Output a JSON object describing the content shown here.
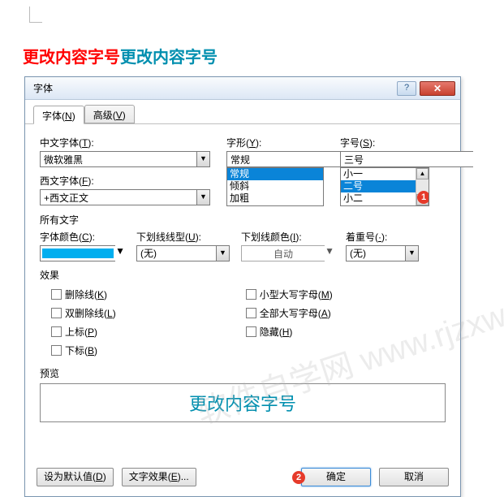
{
  "header": {
    "red": "更改内容字号",
    "teal": "更改内容字号"
  },
  "dialog": {
    "title": "字体",
    "tabs": [
      {
        "label": "字体",
        "accel": "N"
      },
      {
        "label": "高级",
        "accel": "V"
      }
    ],
    "cn_font": {
      "label": "中文字体",
      "accel": "T",
      "value": "微软雅黑"
    },
    "west_font": {
      "label": "西文字体",
      "accel": "F",
      "value": "+西文正文"
    },
    "style": {
      "label": "字形",
      "accel": "Y",
      "value": "常规",
      "options": [
        "常规",
        "倾斜",
        "加粗"
      ]
    },
    "size": {
      "label": "字号",
      "accel": "S",
      "value": "三号",
      "options": [
        "小一",
        "二号",
        "小二"
      ],
      "selected_index": 1
    },
    "all_text": "所有文字",
    "font_color": {
      "label": "字体颜色",
      "accel": "C",
      "swatch": "#00aeef"
    },
    "underline": {
      "label": "下划线线型",
      "accel": "U",
      "value": "(无)"
    },
    "underline_color": {
      "label": "下划线颜色",
      "accel": "I",
      "value": "自动"
    },
    "emphasis": {
      "label": "着重号",
      "accel": "·",
      "value": "(无)"
    },
    "effects_label": "效果",
    "effects_left": [
      {
        "label": "删除线",
        "accel": "K"
      },
      {
        "label": "双删除线",
        "accel": "L"
      },
      {
        "label": "上标",
        "accel": "P"
      },
      {
        "label": "下标",
        "accel": "B"
      }
    ],
    "effects_right": [
      {
        "label": "小型大写字母",
        "accel": "M"
      },
      {
        "label": "全部大写字母",
        "accel": "A"
      },
      {
        "label": "隐藏",
        "accel": "H"
      }
    ],
    "preview_label": "预览",
    "preview_text": "更改内容字号",
    "buttons": {
      "set_default": {
        "label": "设为默认值",
        "accel": "D"
      },
      "text_effects": {
        "label": "文字效果",
        "accel": "E",
        "suffix": "..."
      },
      "ok": "确定",
      "cancel": "取消"
    },
    "badges": {
      "one": "1",
      "two": "2"
    }
  },
  "watermark": "软件自学网\nwww.rjzxw.com"
}
